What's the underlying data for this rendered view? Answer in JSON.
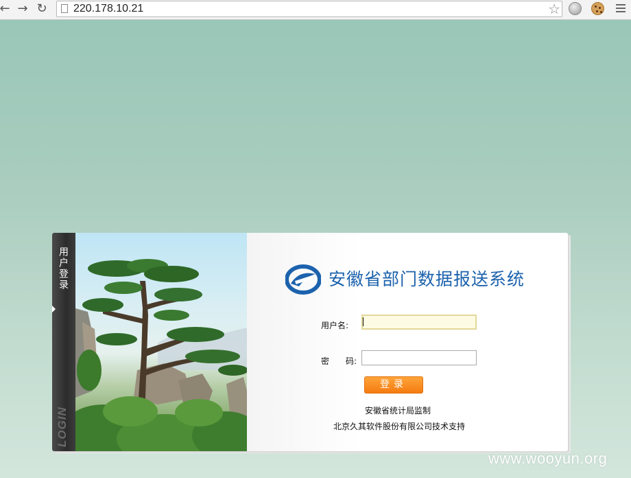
{
  "browser": {
    "url": "220.178.10.21",
    "back_glyph": "←",
    "forward_glyph": "→",
    "reload_glyph": "↻",
    "star_glyph": "☆",
    "icons": [
      "page-icon",
      "star-icon",
      "globe-icon",
      "cookie-icon",
      "menu-icon"
    ]
  },
  "panel": {
    "side_tab_label": "用户登录",
    "side_tab_sub": "LOGIN",
    "title": "安徽省部门数据报送系统",
    "form": {
      "username_label": "用户名:",
      "username_value": "",
      "password_label": "密　　码:",
      "password_value": "",
      "login_button": "登录"
    },
    "supervisor": "安徽省统计局监制",
    "support": "北京久其软件股份有限公司技术支持"
  },
  "watermark": "www.wooyun.org",
  "colors": {
    "title": "#1c62ad",
    "button": "#f47b10",
    "background": "#a9ccbf"
  }
}
